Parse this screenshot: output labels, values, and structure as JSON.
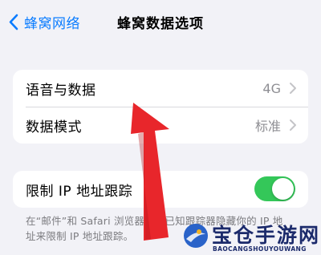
{
  "nav": {
    "back_label": "蜂窝网络",
    "title": "蜂窝数据选项"
  },
  "group1": {
    "rows": [
      {
        "label": "语音与数据",
        "value": "4G"
      },
      {
        "label": "数据模式",
        "value": "标准"
      }
    ]
  },
  "group2": {
    "label": "限制 IP 地址跟踪",
    "toggle_on": true
  },
  "footnote": {
    "line1": "在“邮件”和 Safari 浏览器中对已知跟踪器隐藏你的 IP 地",
    "line2": "址来限制 IP 地址跟踪。"
  },
  "watermark": {
    "title": "宝仓手游网",
    "subtitle": "BAOCANGSHOUYOUWANG"
  },
  "colors": {
    "accent": "#0a7cff",
    "toggle_on": "#34c759",
    "arrow": "#e8262b",
    "background": "#f2f2f7",
    "secondary_text": "#8e8e93"
  },
  "icons": [
    "chevron-left-icon",
    "chevron-right-icon",
    "red-arrow-annotation",
    "watermark-logo-icon"
  ]
}
